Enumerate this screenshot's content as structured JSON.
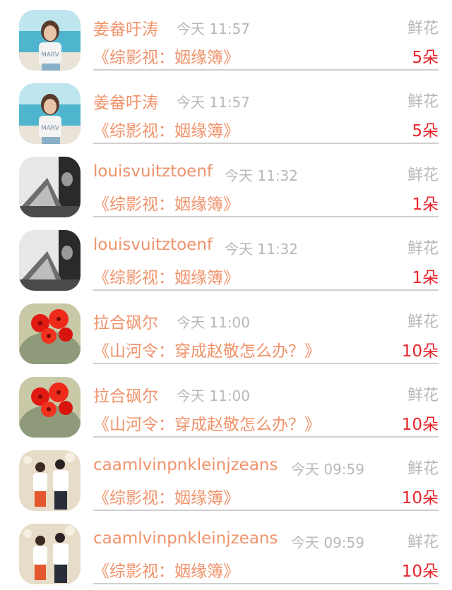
{
  "rows": [
    {
      "user": "姜畚吁涛",
      "time": "今天 11:57",
      "gift": "鲜花",
      "work": "《综影视：姻缘簿》",
      "qty": "5朵",
      "avatar": "beach-woman-avatar"
    },
    {
      "user": "姜畚吁涛",
      "time": "今天 11:57",
      "gift": "鲜花",
      "work": "《综影视：姻缘簿》",
      "qty": "5朵",
      "avatar": "beach-woman-avatar"
    },
    {
      "user": "louisvuitztoenf",
      "time": "今天 11:32",
      "gift": "鲜花",
      "work": "《综影视：姻缘簿》",
      "qty": "1朵",
      "avatar": "bw-photo-avatar"
    },
    {
      "user": "louisvuitztoenf",
      "time": "今天 11:32",
      "gift": "鲜花",
      "work": "《综影视：姻缘簿》",
      "qty": "1朵",
      "avatar": "bw-photo-avatar"
    },
    {
      "user": "拉合砜尔",
      "time": "今天 11:00",
      "gift": "鲜花",
      "work": "《山河令：穿成赵敬怎么办？》",
      "qty": "10朵",
      "avatar": "red-flower-cactus-avatar"
    },
    {
      "user": "拉合砜尔",
      "time": "今天 11:00",
      "gift": "鲜花",
      "work": "《山河令：穿成赵敬怎么办？》",
      "qty": "10朵",
      "avatar": "red-flower-cactus-avatar"
    },
    {
      "user": "caamlvinpnkleinjzeans",
      "time": "今天 09:59",
      "gift": "鲜花",
      "work": "《综影视：姻缘簿》",
      "qty": "10朵",
      "avatar": "couple-photo-avatar"
    },
    {
      "user": "caamlvinpnkleinjzeans",
      "time": "今天 09:59",
      "gift": "鲜花",
      "work": "《综影视：姻缘簿》",
      "qty": "10朵",
      "avatar": "couple-photo-avatar"
    }
  ],
  "colors": {
    "accent": "#f0936b",
    "quantity": "#e8232a",
    "muted": "#b8b8b8",
    "divider": "#cfcfcf"
  }
}
